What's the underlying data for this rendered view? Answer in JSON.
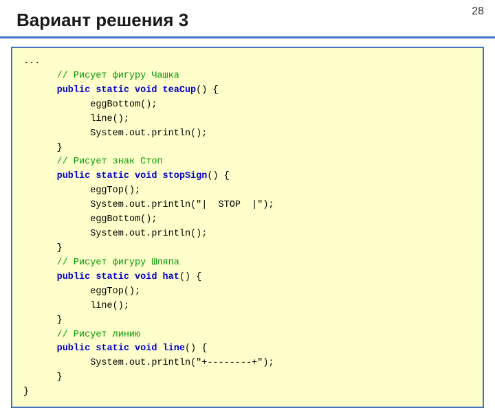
{
  "page": {
    "number": "28",
    "title": "Вариант решения 3"
  },
  "code": {
    "lines": [
      {
        "type": "plain",
        "text": "..."
      },
      {
        "type": "comment",
        "text": "      // Рисует фигуру Чашка"
      },
      {
        "type": "mixed",
        "parts": [
          {
            "t": "kw",
            "v": "      public static void "
          },
          {
            "t": "kw",
            "v": "teaCup"
          },
          {
            "t": "plain",
            "v": "() {"
          }
        ]
      },
      {
        "type": "plain",
        "text": "            eggBottom();"
      },
      {
        "type": "plain",
        "text": "            line();"
      },
      {
        "type": "plain",
        "text": "            System.out.println();"
      },
      {
        "type": "plain",
        "text": "      }"
      },
      {
        "type": "comment",
        "text": "      // Рисует знак Стоп"
      },
      {
        "type": "mixed",
        "parts": [
          {
            "t": "kw",
            "v": "      public static void "
          },
          {
            "t": "kw",
            "v": "stopSign"
          },
          {
            "t": "plain",
            "v": "() {"
          }
        ]
      },
      {
        "type": "plain",
        "text": "            eggTop();"
      },
      {
        "type": "plain",
        "text": "            System.out.println(\"|  STOP  |\");"
      },
      {
        "type": "plain",
        "text": "            eggBottom();"
      },
      {
        "type": "plain",
        "text": "            System.out.println();"
      },
      {
        "type": "plain",
        "text": "      }"
      },
      {
        "type": "comment",
        "text": "      // Рисует фигуру Шляпа"
      },
      {
        "type": "mixed",
        "parts": [
          {
            "t": "kw",
            "v": "      public static void "
          },
          {
            "t": "kw",
            "v": "hat"
          },
          {
            "t": "plain",
            "v": "() {"
          }
        ]
      },
      {
        "type": "plain",
        "text": "            eggTop();"
      },
      {
        "type": "plain",
        "text": "            line();"
      },
      {
        "type": "plain",
        "text": "      }"
      },
      {
        "type": "comment",
        "text": "      // Рисует линию"
      },
      {
        "type": "mixed",
        "parts": [
          {
            "t": "kw",
            "v": "      public static void "
          },
          {
            "t": "kw",
            "v": "line"
          },
          {
            "t": "plain",
            "v": "() {"
          }
        ]
      },
      {
        "type": "plain",
        "text": "            System.out.println(\"+--------+\");"
      },
      {
        "type": "plain",
        "text": "      }"
      },
      {
        "type": "plain",
        "text": "}"
      }
    ]
  }
}
